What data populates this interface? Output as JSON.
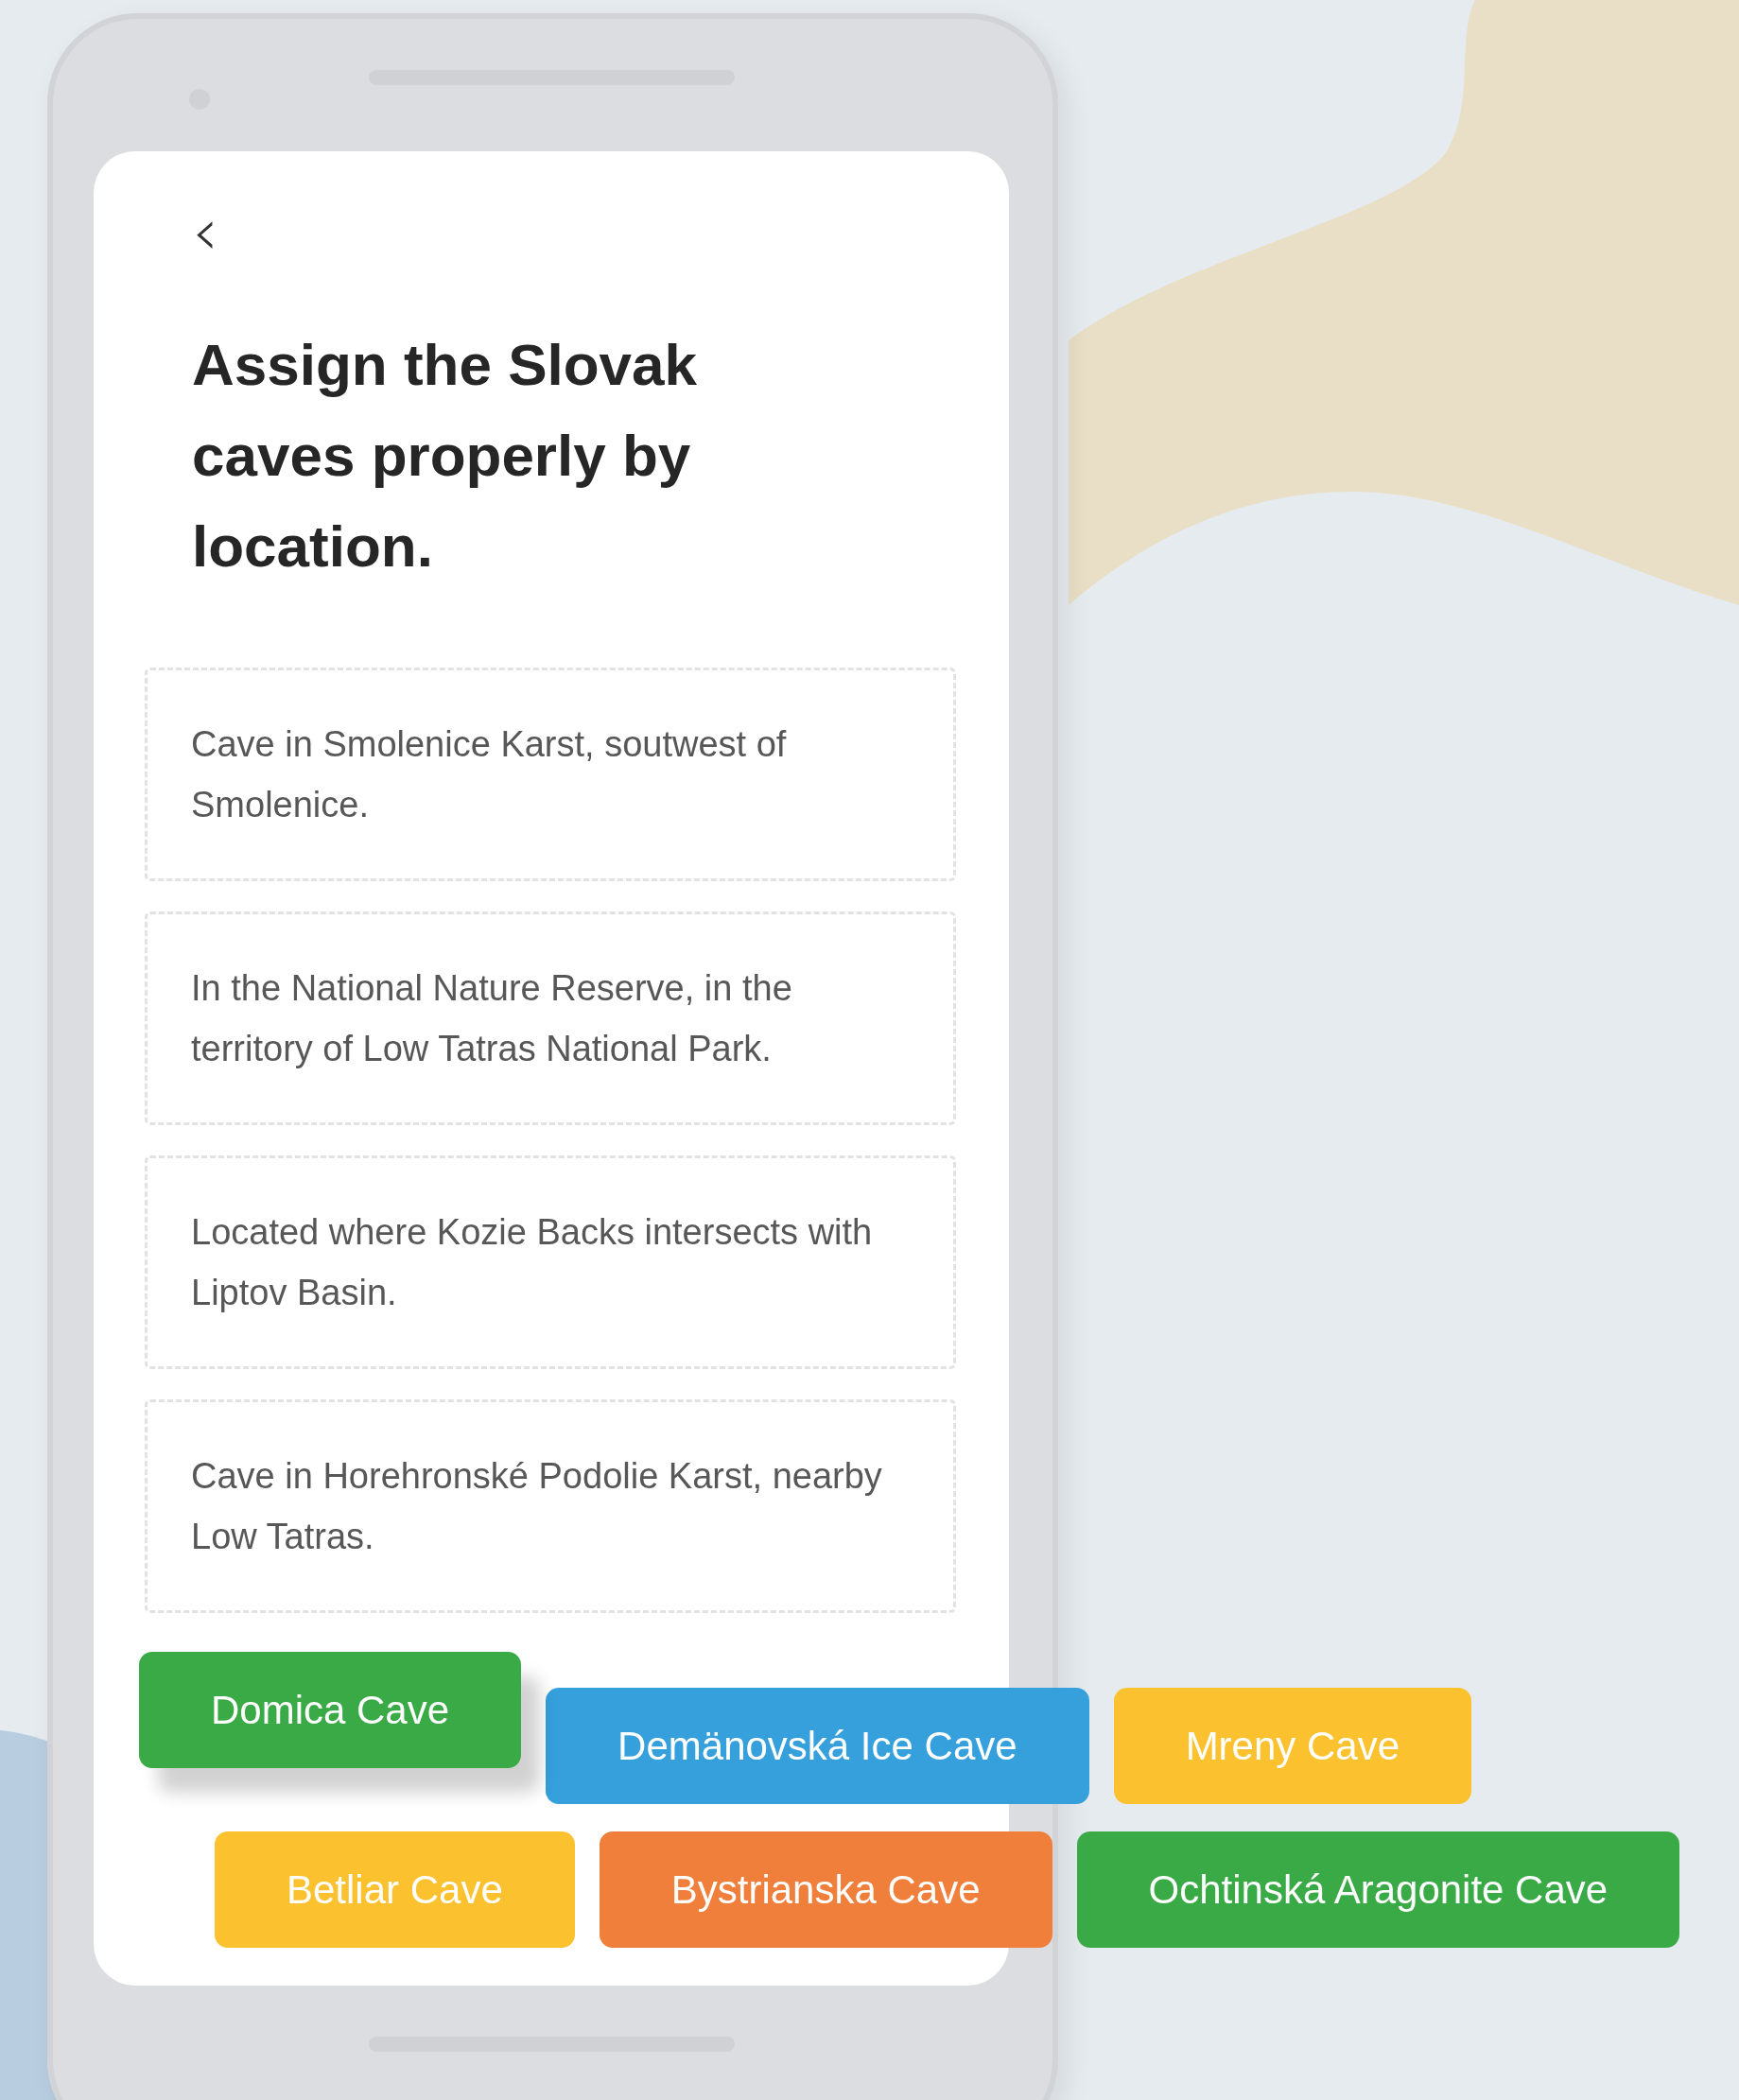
{
  "screen": {
    "back_button": {
      "label": "‹"
    },
    "title": "Assign the Slovak caves properly by location.",
    "clues": [
      {
        "text": "Cave in Smolenice Karst, soutwest of Smolenice."
      },
      {
        "text": "In the National Nature Reserve, in the territory of Low Tatras National Park."
      },
      {
        "text": "Located where Kozie Backs intersects with Liptov Basin."
      },
      {
        "text": "Cave in Horehronské Podolie Karst, nearby Low Tatras."
      }
    ]
  },
  "answer_rows": [
    [
      {
        "label": "Domica Cave",
        "color": "#3aaa47",
        "lifted": true
      },
      {
        "label": "Demänovská Ice Cave",
        "color": "#35a0dc",
        "lifted": false
      },
      {
        "label": "Mreny Cave",
        "color": "#fbc12e",
        "lifted": false
      }
    ],
    [
      {
        "label": "Betliar Cave",
        "color": "#fbc12e",
        "lifted": false
      },
      {
        "label": "Bystrianska Cave",
        "color": "#f07f3c",
        "lifted": false
      },
      {
        "label": "Ochtinská Aragonite Cave",
        "color": "#3aaa47",
        "lifted": false
      }
    ]
  ]
}
